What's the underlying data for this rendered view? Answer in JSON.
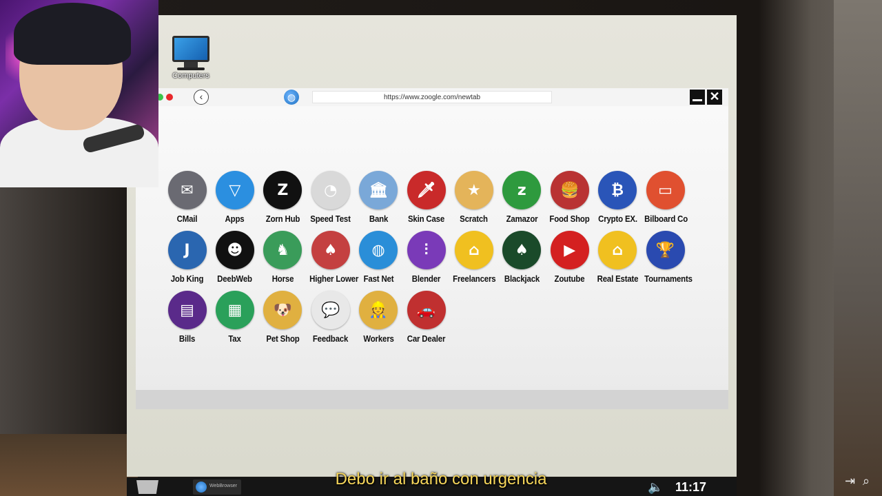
{
  "desktop": {
    "icon_label": "Computers",
    "icon_name": "computer-icon"
  },
  "browser": {
    "url": "https://www.zoogle.com/newtab",
    "apps": [
      {
        "label": "CMail",
        "icon": "mail-icon",
        "color": "#6a6a72",
        "glyph": "✉"
      },
      {
        "label": "Apps",
        "icon": "apps-icon",
        "color": "#2b8fe0",
        "glyph": "▽"
      },
      {
        "label": "Zorn Hub",
        "icon": "zornhub-icon",
        "color": "#111111",
        "glyph": "Z"
      },
      {
        "label": "Speed Test",
        "icon": "speedometer-icon",
        "color": "#d9d9d9",
        "glyph": "◔"
      },
      {
        "label": "Bank",
        "icon": "bank-icon",
        "color": "#7aa8d8",
        "glyph": "🏛"
      },
      {
        "label": "Skin Case",
        "icon": "knife-icon",
        "color": "#c92a2a",
        "glyph": "🗡"
      },
      {
        "label": "Scratch",
        "icon": "scratch-ticket-icon",
        "color": "#e4b45a",
        "glyph": "★"
      },
      {
        "label": "Zamazor",
        "icon": "zamazor-icon",
        "color": "#2e9a3e",
        "glyph": "z"
      },
      {
        "label": "Food Shop",
        "icon": "burger-icon",
        "color": "#b93333",
        "glyph": "🍔"
      },
      {
        "label": "Crypto EX.",
        "icon": "crypto-icon",
        "color": "#2a55b8",
        "glyph": "₿"
      },
      {
        "label": "Bilboard Co",
        "icon": "billboard-icon",
        "color": "#e05030",
        "glyph": "▭"
      },
      {
        "label": "Job King",
        "icon": "jobking-icon",
        "color": "#2a66b0",
        "glyph": "J"
      },
      {
        "label": "DeebWeb",
        "icon": "mask-icon",
        "color": "#111111",
        "glyph": "☻"
      },
      {
        "label": "Horse",
        "icon": "horse-icon",
        "color": "#3a9c5a",
        "glyph": "♞"
      },
      {
        "label": "Higher Lower",
        "icon": "cards-icon",
        "color": "#c44040",
        "glyph": "♠"
      },
      {
        "label": "Fast Net",
        "icon": "globe-icon",
        "color": "#2a8ed8",
        "glyph": "◍"
      },
      {
        "label": "Blender",
        "icon": "mixer-icon",
        "color": "#7a3ab8",
        "glyph": "⫶"
      },
      {
        "label": "Freelancers",
        "icon": "freelancer-icon",
        "color": "#f0c020",
        "glyph": "⌂"
      },
      {
        "label": "Blackjack",
        "icon": "blackjack-icon",
        "color": "#1a4a2a",
        "glyph": "♠"
      },
      {
        "label": "Zoutube",
        "icon": "play-icon",
        "color": "#d42020",
        "glyph": "▶"
      },
      {
        "label": "Real Estate",
        "icon": "house-icon",
        "color": "#f0c020",
        "glyph": "⌂"
      },
      {
        "label": "Tournaments",
        "icon": "trophy-icon",
        "color": "#2a4ab0",
        "glyph": "🏆"
      },
      {
        "label": "Bills",
        "icon": "bill-icon",
        "color": "#5a2a8a",
        "glyph": "▤"
      },
      {
        "label": "Tax",
        "icon": "tax-icon",
        "color": "#2aa05a",
        "glyph": "▦"
      },
      {
        "label": "Pet Shop",
        "icon": "dog-icon",
        "color": "#e0b040",
        "glyph": "🐶"
      },
      {
        "label": "Feedback",
        "icon": "chat-icon",
        "color": "#e8e8e8",
        "glyph": "💬"
      },
      {
        "label": "Workers",
        "icon": "worker-icon",
        "color": "#e0b040",
        "glyph": "👷"
      },
      {
        "label": "Car Dealer",
        "icon": "car-icon",
        "color": "#c03030",
        "glyph": "🚗"
      }
    ]
  },
  "taskbar": {
    "task_label": "WebBrowser",
    "clock": "11:17"
  },
  "subtitle": "Debo ir al baño con urgencia"
}
